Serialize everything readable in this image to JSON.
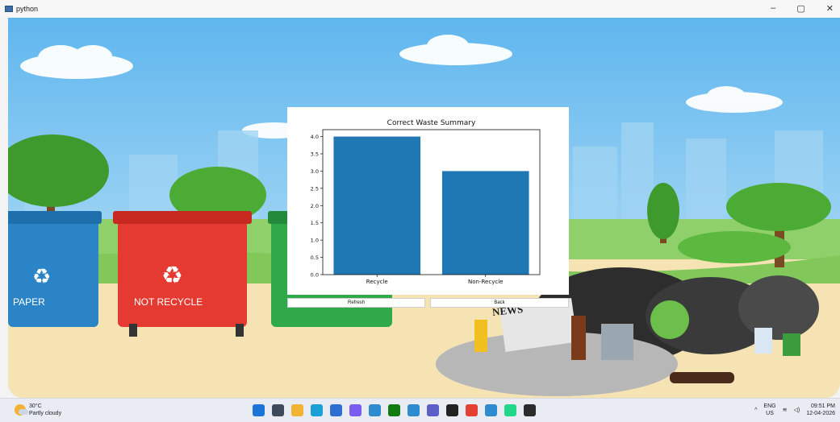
{
  "window": {
    "title": "python",
    "controls": {
      "minimize": "–",
      "maximize": "▢",
      "close": "✕"
    }
  },
  "scene": {
    "bins": [
      {
        "label": "PAPER",
        "color": "#2a84c6"
      },
      {
        "label": "NOT RECYCLE",
        "color": "#e53a31"
      },
      {
        "label": "",
        "color": "#2fa94a"
      }
    ],
    "news_label": "NEWS"
  },
  "chart_data": {
    "type": "bar",
    "title": "Correct Waste Summary",
    "categories": [
      "Recycle",
      "Non-Recycle"
    ],
    "values": [
      4,
      3
    ],
    "ylim": [
      0,
      4.2
    ],
    "yticks": [
      "0.0",
      "0.5",
      "1.0",
      "1.5",
      "2.0",
      "2.5",
      "3.0",
      "3.5",
      "4.0"
    ],
    "bar_color": "#1f77b4",
    "xlabel": "",
    "ylabel": ""
  },
  "buttons": {
    "refresh": "Refresh",
    "back": "Back"
  },
  "taskbar": {
    "weather": {
      "temp": "30°C",
      "desc": "Partly cloudy"
    },
    "apps": [
      "start",
      "search",
      "file-explorer",
      "edge",
      "store",
      "copilot",
      "app",
      "xbox",
      "app",
      "teams",
      "chatgpt",
      "chrome",
      "app",
      "pycharm",
      "terminal"
    ],
    "language": {
      "top": "ENG",
      "bottom": "US"
    },
    "clock": {
      "time": "09:51 PM",
      "date": "12-04-2026"
    },
    "colors": {
      "start": "#1c74d9"
    }
  }
}
